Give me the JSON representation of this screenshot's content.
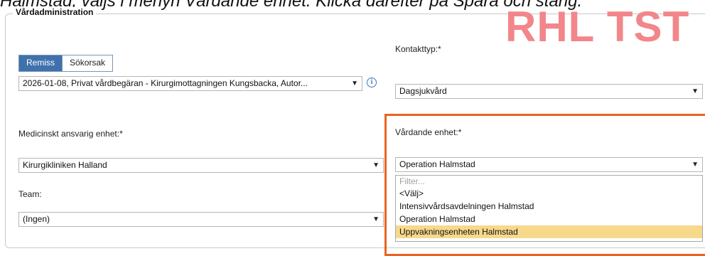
{
  "instruction": "Halmstad, väljs i menyn Vårdande enhet. Klicka därefter på Spara och stäng.",
  "section": {
    "legend": "Vårdadministration"
  },
  "watermark": "RHL TST",
  "referral_toggle": {
    "options": [
      "Remiss",
      "Sökorsak"
    ],
    "selected": "Remiss"
  },
  "referral_select": {
    "value": "2026-01-08, Privat vårdbegäran  - Kirurgimottagningen Kungsbacka, Autor..."
  },
  "contact_type": {
    "label": "Kontakttyp:*",
    "value": "Dagsjukvård"
  },
  "responsible_unit": {
    "label": "Medicinskt ansvarig enhet:*",
    "value": "Kirurgikliniken Halland"
  },
  "care_unit": {
    "label": "Vårdande enhet:*",
    "value": "Operation Halmstad",
    "filter_placeholder": "Filter...",
    "options": [
      "<Välj>",
      "Intensivvårdsavdelningen Halmstad",
      "Operation Halmstad",
      "Uppvakningsenheten Halmstad"
    ],
    "hovered": "Uppvakningsenheten Halmstad"
  },
  "team": {
    "label": "Team:",
    "value": "(Ingen)"
  },
  "icons": {
    "info": "info-icon",
    "dropdown": "chevron-down-icon"
  },
  "colors": {
    "toggle_active": "#3f72ad",
    "highlight_border": "#e8641f",
    "watermark": "#f2868a",
    "hover_option": "#f7d98c"
  }
}
